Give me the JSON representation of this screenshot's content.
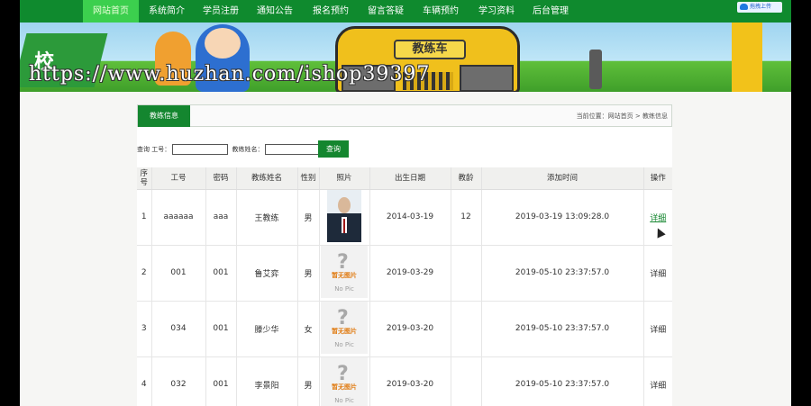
{
  "nav": {
    "items": [
      {
        "label": "网站首页",
        "active": true
      },
      {
        "label": "系统简介",
        "active": false
      },
      {
        "label": "学员注册",
        "active": false
      },
      {
        "label": "通知公告",
        "active": false
      },
      {
        "label": "报名预约",
        "active": false
      },
      {
        "label": "留言答疑",
        "active": false
      },
      {
        "label": "车辆预约",
        "active": false
      },
      {
        "label": "学习资料",
        "active": false
      },
      {
        "label": "后台管理",
        "active": false
      }
    ],
    "upload_badge": "拖拽上传"
  },
  "banner": {
    "bus_sign": "教练车",
    "left_sign": "校",
    "watermark": "https://www.huzhan.com/ishop39397"
  },
  "panel": {
    "tab_label": "教练信息",
    "breadcrumb": "当前位置：网站首页 > 教练信息"
  },
  "search": {
    "id_label": "查询 工号：",
    "name_label": "教练姓名：",
    "button_label": "查询"
  },
  "table": {
    "headers": [
      "序号",
      "工号",
      "密码",
      "教练姓名",
      "性别",
      "照片",
      "出生日期",
      "教龄",
      "添加时间",
      "操作"
    ],
    "rows": [
      {
        "no": "1",
        "id": "aaaaaa",
        "password": "aaa",
        "name": "王教练",
        "gender": "男",
        "photo": "real",
        "birth": "2014-03-19",
        "years": "12",
        "added": "2019-03-19 13:09:28.0",
        "action": "详细",
        "action_link": true
      },
      {
        "no": "2",
        "id": "001",
        "password": "001",
        "name": "鲁艾弈",
        "gender": "男",
        "photo": "none",
        "birth": "2019-03-29",
        "years": "",
        "added": "2019-05-10 23:37:57.0",
        "action": "详细",
        "action_link": false
      },
      {
        "no": "3",
        "id": "034",
        "password": "001",
        "name": "滕少华",
        "gender": "女",
        "photo": "none",
        "birth": "2019-03-20",
        "years": "",
        "added": "2019-05-10 23:37:57.0",
        "action": "详细",
        "action_link": false
      },
      {
        "no": "4",
        "id": "032",
        "password": "001",
        "name": "李景阳",
        "gender": "男",
        "photo": "none",
        "birth": "2019-03-20",
        "years": "",
        "added": "2019-05-10 23:37:57.0",
        "action": "详细",
        "action_link": false
      }
    ],
    "no_pic_cn": "暂无图片",
    "no_pic_en": "No Pic"
  }
}
